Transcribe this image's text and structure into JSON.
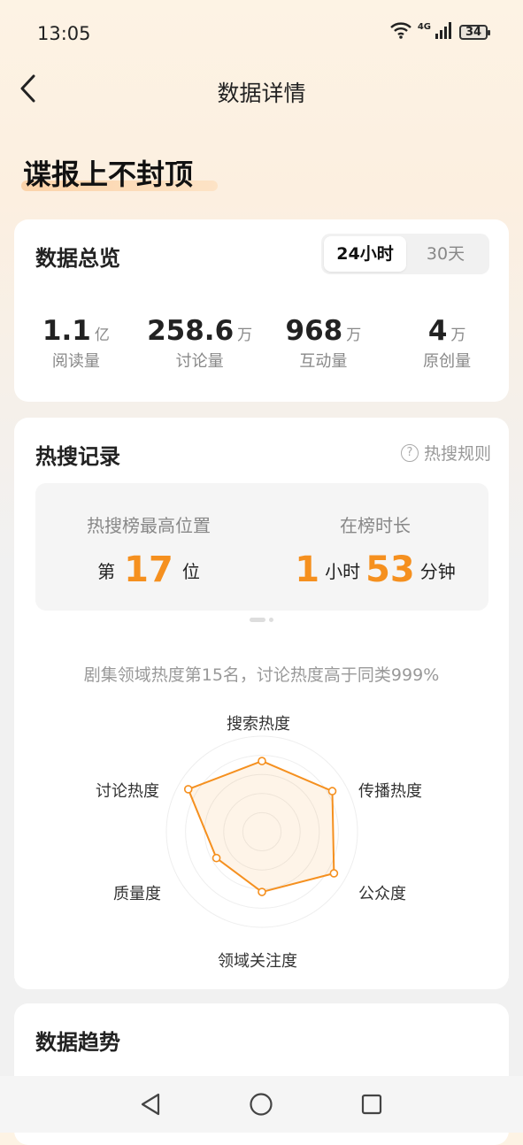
{
  "status_bar": {
    "time": "13:05",
    "network": "4G",
    "battery": "34"
  },
  "nav": {
    "title": "数据详情"
  },
  "topic": {
    "title": "谍报上不封顶"
  },
  "overview": {
    "title": "数据总览",
    "tabs": [
      "24小时",
      "30天"
    ],
    "stats": [
      {
        "value": "1.1",
        "unit": "亿",
        "label": "阅读量"
      },
      {
        "value": "258.6",
        "unit": "万",
        "label": "讨论量"
      },
      {
        "value": "968",
        "unit": "万",
        "label": "互动量"
      },
      {
        "value": "4",
        "unit": "万",
        "label": "原创量"
      }
    ]
  },
  "hot_search": {
    "title": "热搜记录",
    "rules_label": "热搜规则",
    "rank": {
      "label": "热搜榜最高位置",
      "prefix": "第",
      "value": "17",
      "suffix": "位"
    },
    "duration": {
      "label": "在榜时长",
      "hours": "1",
      "hours_unit": "小时",
      "minutes": "53",
      "minutes_unit": "分钟"
    },
    "summary": "剧集领域热度第15名，讨论热度高于同类999%",
    "radar": {
      "axes": [
        "搜索热度",
        "传播热度",
        "公众度",
        "领域关注度",
        "质量度",
        "讨论热度"
      ],
      "values": [
        0.74,
        0.85,
        0.87,
        0.63,
        0.55,
        0.89
      ],
      "color": "#f5901f"
    }
  },
  "trend": {
    "title": "数据趋势"
  }
}
